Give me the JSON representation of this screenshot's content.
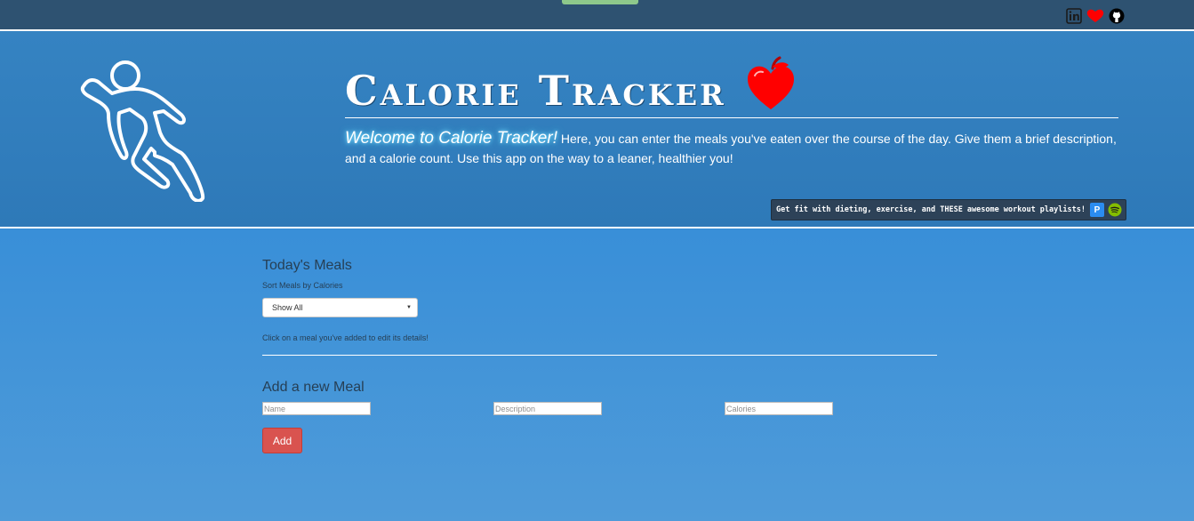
{
  "social": {
    "icons": [
      "linkedin-icon",
      "heart-icon",
      "github-icon"
    ],
    "colors": {
      "linkedin": "#1b1b1b",
      "heart": "#ff0000",
      "github": "#000000"
    }
  },
  "header": {
    "title": "Calorie Tracker",
    "welcome": "Welcome to Calorie Tracker!",
    "intro": " Here, you can enter the meals you've eaten over the course of the day. Give them a brief description, and a calorie count. Use this app on the way to a leaner, healthier you!",
    "playlist_text": "Get fit with dieting, exercise, and THESE awesome workout playlists!",
    "playlist_buttons": [
      "pandora-icon",
      "spotify-icon"
    ],
    "pandora_letter": "P"
  },
  "meals": {
    "heading": "Today's Meals",
    "sort_label": "Sort Meals by Calories",
    "sort_selected": "Show All",
    "hint": "Click on a meal you've added to edit its details!"
  },
  "add_meal": {
    "heading": "Add a new Meal",
    "name_placeholder": "Name",
    "description_placeholder": "Description",
    "calories_placeholder": "Calories",
    "add_label": "Add"
  },
  "colors": {
    "topbar": "#2e5271",
    "banner": "#3583c2",
    "page_background": "#2787d8",
    "add_button": "#d9534f",
    "heading_text": "#263f55"
  }
}
